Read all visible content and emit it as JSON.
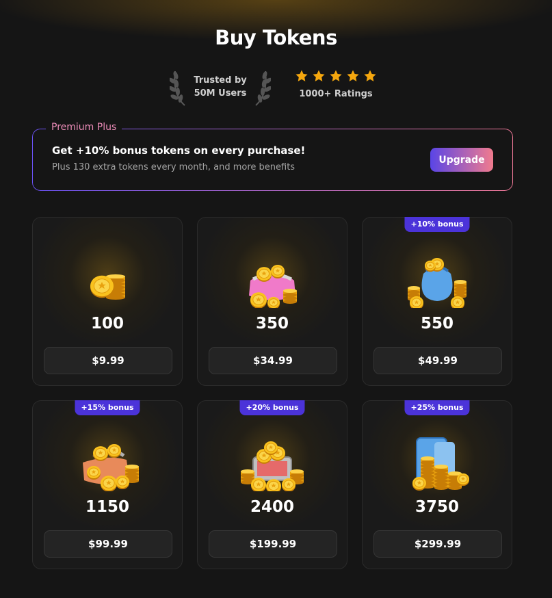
{
  "header": {
    "title": "Buy Tokens"
  },
  "trust": {
    "line1": "Trusted by",
    "line2": "50M Users"
  },
  "rating": {
    "stars": 5,
    "label": "1000+ Ratings",
    "star_color": "#f5a70e"
  },
  "premium": {
    "legend": "Premium Plus",
    "title": "Get +10% bonus tokens on every purchase!",
    "subtitle": "Plus 130 extra tokens every month, and more benefits",
    "button_label": "Upgrade"
  },
  "packages": [
    {
      "amount": "100",
      "price": "$9.99",
      "bonus": "",
      "icon": "coin-stack-icon"
    },
    {
      "amount": "350",
      "price": "$34.99",
      "bonus": "",
      "icon": "coin-purse-icon"
    },
    {
      "amount": "550",
      "price": "$49.99",
      "bonus": "+10% bonus",
      "icon": "coin-sack-icon"
    },
    {
      "amount": "1150",
      "price": "$99.99",
      "bonus": "+15% bonus",
      "icon": "coin-bag-icon"
    },
    {
      "amount": "2400",
      "price": "$199.99",
      "bonus": "+20% bonus",
      "icon": "coin-chest-icon"
    },
    {
      "amount": "3750",
      "price": "$299.99",
      "bonus": "+25% bonus",
      "icon": "coin-vault-icon"
    }
  ],
  "colors": {
    "accent": "#4b33d9",
    "gold": "#f5b818",
    "pink": "#f17b8e"
  }
}
